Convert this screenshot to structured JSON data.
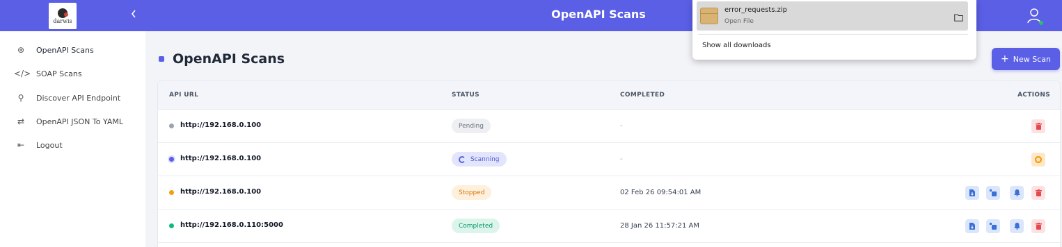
{
  "header": {
    "logo_text": "darwis",
    "collapse_icon": "chevron-left-icon",
    "title": "OpenAPI Scans",
    "user_icon": "user-online-icon"
  },
  "sidebar": {
    "items": [
      {
        "label": "OpenAPI Scans",
        "icon": "lifebuoy-icon",
        "glyph": "⊛"
      },
      {
        "label": "SOAP Scans",
        "icon": "code-icon",
        "glyph": "</>"
      },
      {
        "label": "Discover API Endpoint",
        "icon": "search-icon",
        "glyph": "⚲"
      },
      {
        "label": "OpenAPI JSON To YAML",
        "icon": "swap-arrows-icon",
        "glyph": "⇄"
      },
      {
        "label": "Logout",
        "icon": "logout-icon",
        "glyph": "⇤"
      }
    ]
  },
  "main": {
    "title": "OpenAPI Scans",
    "new_scan_label": "New Scan",
    "columns": [
      "API URL",
      "STATUS",
      "COMPLETED",
      "ACTIONS"
    ],
    "rows": [
      {
        "url": "http://192.168.0.100",
        "status": "Pending",
        "completed": "-",
        "dot_color": "#9ca3af"
      },
      {
        "url": "http://192.168.0.100",
        "status": "Scanning",
        "completed": "-",
        "dot_color": "#5a5fe6"
      },
      {
        "url": "http://192.168.0.100",
        "status": "Stopped",
        "completed": "02 Feb 26 09:54:01 AM",
        "dot_color": "#f59e0b"
      },
      {
        "url": "http://192.168.0.110:5000",
        "status": "Completed",
        "completed": "28 Jan 26 11:57:21 AM",
        "dot_color": "#10b981"
      }
    ]
  },
  "downloads_popup": {
    "file_name": "error_requests.zip",
    "file_action": "Open File",
    "show_all": "Show all downloads"
  },
  "colors": {
    "accent": "#5a5fe6",
    "pending": "#9ca3af",
    "scanning": "#5a5fe6",
    "stopped": "#f59e0b",
    "completed": "#10b981",
    "danger": "#e5484d"
  }
}
